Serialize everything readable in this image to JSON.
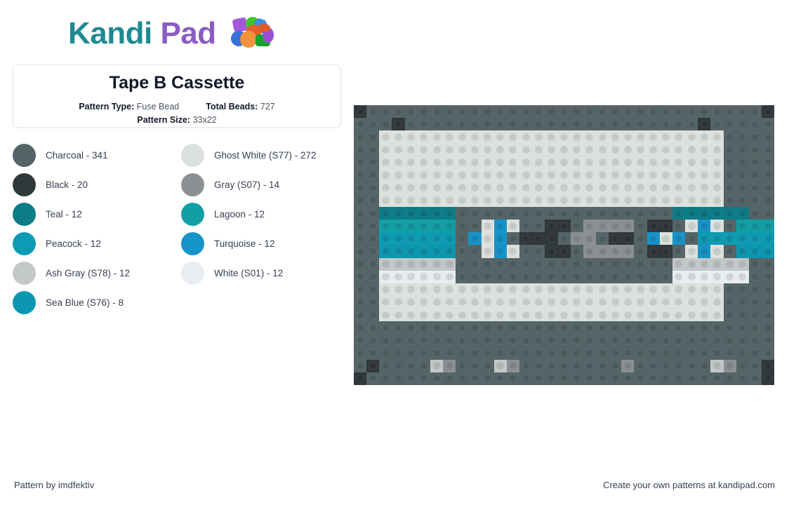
{
  "brand": {
    "name_part1": "Kandi",
    "name_part2": " Pad",
    "logo_icon": "kandi-beads-icon",
    "color_kandi": "#1f8a92",
    "color_pad": "#8a5cc4"
  },
  "pattern": {
    "title": "Tape B Cassette",
    "type_label": "Pattern Type:",
    "type_value": "Fuse Bead",
    "total_label": "Total Beads:",
    "total_value": "727",
    "size_label": "Pattern Size:",
    "size_value": "33x22"
  },
  "legend": {
    "items": [
      {
        "label": "Charcoal - 341",
        "color": "#556467",
        "key": "C"
      },
      {
        "label": "Black - 20",
        "color": "#31383a",
        "key": "K"
      },
      {
        "label": "Teal - 12",
        "color": "#0c7c86",
        "key": "T"
      },
      {
        "label": "Peacock - 12",
        "color": "#0d9bb3",
        "key": "P"
      },
      {
        "label": "Ash Gray (S78) - 12",
        "color": "#c4c7c8",
        "key": "A"
      },
      {
        "label": "Sea Blue (S76) - 8",
        "color": "#0c97b0",
        "key": "B"
      },
      {
        "label": "Ghost White (S77) - 272",
        "color": "#dde1dd",
        "key": "G"
      },
      {
        "label": "Gray (S07) - 14",
        "color": "#8b9092",
        "key": "Y"
      },
      {
        "label": "Lagoon - 12",
        "color": "#119fa5",
        "key": "L"
      },
      {
        "label": "Turquoise - 12",
        "color": "#1694c9",
        "key": "Q"
      },
      {
        "label": "White (S01) - 12",
        "color": "#e8edf2",
        "key": "W"
      }
    ]
  },
  "grid": {
    "cols": 33,
    "rows": 22,
    "palette": {
      "C": "#556467",
      "K": "#31383a",
      "T": "#0c7c86",
      "P": "#0d9bb3",
      "A": "#c4c7c8",
      "B": "#0c97b0",
      "G": "#dde1dd",
      "Y": "#8b9092",
      "L": "#119fa5",
      "Q": "#1694c9",
      "W": "#e8edf2"
    },
    "rows_data": [
      "KCCCCCCCCCCCCCCCCCCCCCCCCCCCCCCCK",
      "CCCKCCCCCCCCCCCCCCCCCCCCCCCKCCCCC",
      "CCGGGGGGGGGGGGGGGGGGGGGGGGGGGCCCC",
      "CCGGGGGGGGGGGGGGGGGGGGGGGGGGGCCCC",
      "CCGGGGGGGGGGGGGGGGGGGGGGGGGGGCCCC",
      "CCGGGGGGGGGGGGGGGGGGGGGGGGGGGCCCC",
      "CCGGGGGGGGGGGGGGGGGGGGGGGGGGGCCCC",
      "CCGGGGGGGGGGGGGGGGGGGGGGGGGGGCCCC",
      "CCTTTTTTCCCCCCCCCCCCCCCCCTTTTTTCCC",
      "CCLLLLLLCCGQGCCKKCYYYYCKKCGQGCLLLLL",
      "CCPPPPPPCQGQCKKKCYYCKKCQGQCPPPPPPCC",
      "CCBBBBBBCCGQGCCKKCYYYYCKKCGQGCBBBBB",
      "CCAAAAAACCCCCCCCCCCCCCCCCAAAAAACCC",
      "CCWWWWWWCCCCCCCCCCCCCCCCCWWWWWWCCC",
      "CCGGGGGGGGGGGGGGGGGGGGGGGGGGGCCCC",
      "CCGGGGGGGGGGGGGGGGGGGGGGGGGGGCCCC",
      "CCGGGGGGGGGGGGGGGGGGGGGGGGGGGCCCC",
      "CCCCCCCCCCCCCCCCCCCCCCCCCCCCCCCCC",
      "CCCCCCCCCCCCCCCCCCCCCCCCCCCCCCCCC",
      "CCCCCCCCCCCCCCCCCCCCCCCCCCCCCCCCC",
      "CKCCCCAYCCCAYCCCCCCCCYCCCCCCAYCCKC",
      "KCCCCCCCCCCCCCCCCCCCCCCCCCCCCCCCK"
    ]
  },
  "footer": {
    "left": "Pattern by imdfektiv",
    "right": "Create your own patterns at kandipad.com"
  }
}
